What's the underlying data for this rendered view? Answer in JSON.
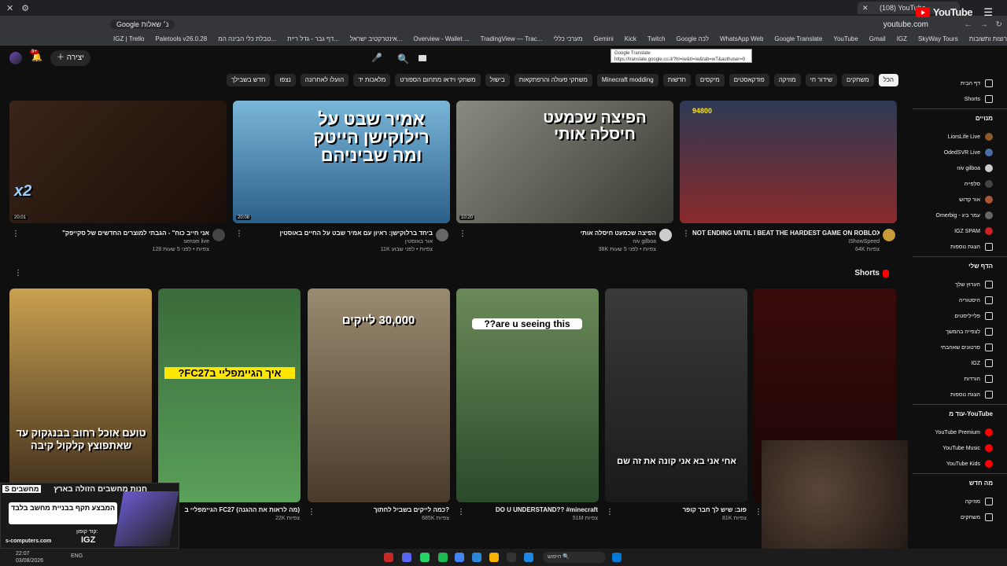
{
  "browser": {
    "tab_title": "(108) YouTube",
    "url": "youtube.com",
    "ext_label": "Google נ׳ שאלות",
    "bookmarks": [
      "IGZ | Trello",
      "Paletools v26.0.28",
      "טבלת כלי הבינה המ...",
      "דף גבר - גדל ריית...",
      "אינטרקטיב ישראל...",
      "Overview - Wallet ...",
      "TradingView — Trac...",
      "מערכי כללי",
      "Gemini",
      "Kick",
      "Twitch",
      "Google לכה",
      "WhatsApp Web",
      "Google Translate",
      "YouTube",
      "Gmail",
      "IGZ",
      "SkyWay Tours",
      "פרוצות ותשובות",
      "משחקים"
    ],
    "tooltip_title": "Google Translate",
    "tooltip_url": "https://translate.google.co.il/?hl=iw&tl=iw&tab=wT&authuser=0"
  },
  "header": {
    "create_label": "יצירה",
    "logo_text": "YouTube",
    "notif_count": "9+"
  },
  "chips": [
    "הכל",
    "משחקים",
    "שידור חי",
    "מוזיקה",
    "פודקאסטים",
    "מיקסים",
    "חדשות",
    "Minecraft modding",
    "משחקי פעולה והרפתקאות",
    "בישול",
    "משחקי וידאו מתחום הספורט",
    "מלאכות יד",
    "הועלו לאחרונה",
    "נצפו",
    "חדש בשבילך"
  ],
  "videos": [
    {
      "title": "\"אני חייב כוח\" - הגבתי למוצרים החדשים של סקייפק",
      "channel": "sensei live",
      "meta": "128 צפיות • לפני 5 שעות",
      "duration": "20:01",
      "overlay": "x2"
    },
    {
      "title": "ביחד ברלוקישן: ראיון עם אמיר שבט על החיים באוסטין",
      "channel": "אור באוסטין",
      "meta": "11K צפיות • לפני שבוע",
      "duration": "20:08",
      "overlay": "אמיר שבט על רילוקישן הייטק ומה שביניהם"
    },
    {
      "title": "הפיצה שכמעט חיסלה אותי",
      "channel": "niv gilboa",
      "meta": "38K צפיות • לפני 5 שעות",
      "duration": "10:20",
      "overlay": "הפיצה שכמעט חיסלה אותי"
    },
    {
      "title": "NOT ENDING UNTIL I BEAT THE HARDEST GAME ON ROBLOX",
      "channel": "IShowSpeed",
      "meta": "64K צפיות",
      "duration": "",
      "overlay": "94800"
    }
  ],
  "shorts_title": "Shorts",
  "shorts": [
    {
      "title": "טועם אוכל רחוב בבנגקוק",
      "meta": "",
      "overlay": "טועם אוכל רחוב בבנגקוק עד שאתפוצץ קלקול קיבה"
    },
    {
      "title": "הגיימפליי ב FC27 (מה לראות את ההגנה)",
      "meta": "22K צפיות",
      "overlay": "איך הגיימפליי בFC27?"
    },
    {
      "title": "כמה לייקים בשביל לחתוך?",
      "meta": "685K צפיות",
      "overlay": "30,000 לייקים"
    },
    {
      "title": "DO U UNDERSTAND?? #minecraft",
      "meta": "51M צפיות",
      "overlay": "are u seeing this??"
    },
    {
      "title": "פוב: שיש לך חבר קופר",
      "meta": "81K צפיות",
      "overlay": "אחי אני בא אני קונה את זה שם"
    },
    {
      "title": "",
      "meta": "",
      "overlay": ""
    }
  ],
  "sidebar": {
    "main": [
      {
        "label": "דף הבית"
      },
      {
        "label": "Shorts"
      }
    ],
    "subs_head": "מנויים",
    "subs": [
      {
        "label": "LiorsLife Live",
        "color": "#8b5a2b"
      },
      {
        "label": "OdedSVR Live",
        "color": "#4a6fa5"
      },
      {
        "label": "niv gilboa",
        "color": "#cccccc"
      },
      {
        "label": "סלפייה",
        "color": "#444444"
      },
      {
        "label": "אור קדוש",
        "color": "#aa5533"
      },
      {
        "label": "Omerbig - עמר ביג",
        "color": "#666666"
      },
      {
        "label": "IGZ SPAM",
        "color": "#cc2222"
      }
    ],
    "subs_more": "הצגת נוספות",
    "you_head": "הדף שלי",
    "you": [
      {
        "label": "הערוץ שלך"
      },
      {
        "label": "היסטוריה"
      },
      {
        "label": "פלייליסטים"
      },
      {
        "label": "לצפייה בהמשך"
      },
      {
        "label": "סרטונים שאהבתי"
      },
      {
        "label": "IGZ"
      },
      {
        "label": "הורדות"
      }
    ],
    "you_more": "הצגת נוספות",
    "more_head": "עוד מ-YouTube",
    "more": [
      {
        "label": "YouTube Premium"
      },
      {
        "label": "YouTube Music"
      },
      {
        "label": "YouTube Kids"
      }
    ],
    "new_head": "מה חדש",
    "new": [
      {
        "label": "מוזיקה"
      },
      {
        "label": "משחקים"
      }
    ]
  },
  "ad": {
    "line1": "חנות מחשבים הזולה בארץ",
    "line2": "המבצע תקף בבניית מחשב בלבד",
    "site": "s-computers.com",
    "code_label": "קוד קופון:",
    "code": "IGZ",
    "brand": "S מחשבים"
  },
  "taskbar": {
    "time": "22:07",
    "date": "03/08/2026",
    "search": "חיפוש",
    "lang": "ENG"
  }
}
